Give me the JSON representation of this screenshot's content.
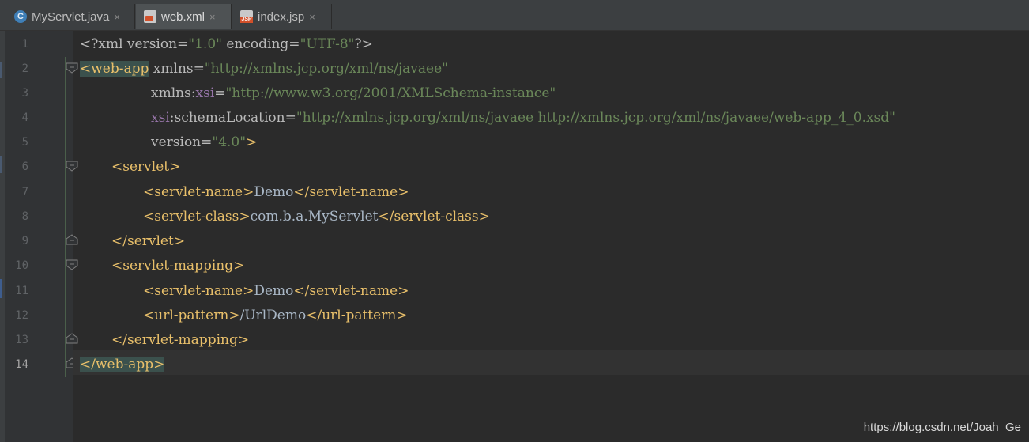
{
  "tabs": [
    {
      "label": "MyServlet.java",
      "icon": "java-class-icon",
      "active": false
    },
    {
      "label": "web.xml",
      "icon": "xml-file-icon",
      "active": true
    },
    {
      "label": "index.jsp",
      "icon": "jsp-file-icon",
      "active": false
    }
  ],
  "close_glyph": "×",
  "line_numbers": [
    "1",
    "2",
    "3",
    "4",
    "5",
    "6",
    "7",
    "8",
    "9",
    "10",
    "11",
    "12",
    "13",
    "14"
  ],
  "code": {
    "l1": {
      "decl_open": "<?xml version=",
      "version_val": "\"1.0\"",
      "enc_attr": " encoding=",
      "enc_val": "\"UTF-8\"",
      "decl_close": "?>"
    },
    "l2": {
      "bracket": "<",
      "tag": "web-app",
      "attr": " xmlns=",
      "val": "\"http://xmlns.jcp.org/xml/ns/javaee\""
    },
    "l3": {
      "attr": "xmlns:",
      "ns": "xsi",
      "eq": "=",
      "val": "\"http://www.w3.org/2001/XMLSchema-instance\""
    },
    "l4": {
      "ns": "xsi",
      "attr": ":schemaLocation=",
      "val": "\"http://xmlns.jcp.org/xml/ns/javaee http://xmlns.jcp.org/xml/ns/javaee/web-app_4_0.xsd\""
    },
    "l5": {
      "attr": "version=",
      "val": "\"4.0\"",
      "close": ">"
    },
    "l6": {
      "tag": "<servlet>"
    },
    "l7": {
      "open": "<servlet-name>",
      "text": "Demo",
      "close": "</servlet-name>"
    },
    "l8": {
      "open": "<servlet-class>",
      "text": "com.b.a.MyServlet",
      "close": "</servlet-class>"
    },
    "l9": {
      "tag": "</servlet>"
    },
    "l10": {
      "tag": "<servlet-mapping>"
    },
    "l11": {
      "open": "<servlet-name>",
      "text": "Demo",
      "close": "</servlet-name>"
    },
    "l12": {
      "open": "<url-pattern>",
      "text": "/UrlDemo",
      "close": "</url-pattern>"
    },
    "l13": {
      "tag": "</servlet-mapping>"
    },
    "l14": {
      "tag": "</web-app>"
    }
  },
  "current_line": 14,
  "watermark": "https://blog.csdn.net/Joah_Ge",
  "colors": {
    "tag": "#e8bf6a",
    "attribute": "#bababa",
    "value": "#6a8759",
    "namespace": "#9876aa",
    "background": "#2b2b2b"
  }
}
